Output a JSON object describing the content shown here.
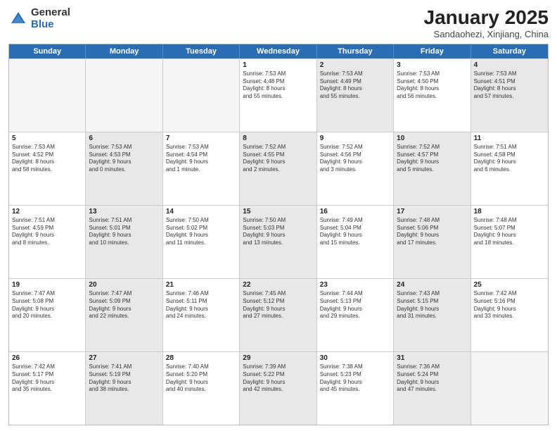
{
  "logo": {
    "general": "General",
    "blue": "Blue"
  },
  "header": {
    "title": "January 2025",
    "subtitle": "Sandaohezi, Xinjiang, China"
  },
  "weekdays": [
    "Sunday",
    "Monday",
    "Tuesday",
    "Wednesday",
    "Thursday",
    "Friday",
    "Saturday"
  ],
  "weeks": [
    [
      {
        "day": "",
        "empty": true,
        "shaded": false,
        "info": ""
      },
      {
        "day": "",
        "empty": true,
        "shaded": false,
        "info": ""
      },
      {
        "day": "",
        "empty": true,
        "shaded": false,
        "info": ""
      },
      {
        "day": "1",
        "empty": false,
        "shaded": false,
        "info": "Sunrise: 7:53 AM\nSunset: 4:48 PM\nDaylight: 8 hours\nand 55 minutes."
      },
      {
        "day": "2",
        "empty": false,
        "shaded": true,
        "info": "Sunrise: 7:53 AM\nSunset: 4:49 PM\nDaylight: 8 hours\nand 55 minutes."
      },
      {
        "day": "3",
        "empty": false,
        "shaded": false,
        "info": "Sunrise: 7:53 AM\nSunset: 4:50 PM\nDaylight: 8 hours\nand 56 minutes."
      },
      {
        "day": "4",
        "empty": false,
        "shaded": true,
        "info": "Sunrise: 7:53 AM\nSunset: 4:51 PM\nDaylight: 8 hours\nand 57 minutes."
      }
    ],
    [
      {
        "day": "5",
        "empty": false,
        "shaded": false,
        "info": "Sunrise: 7:53 AM\nSunset: 4:52 PM\nDaylight: 8 hours\nand 58 minutes."
      },
      {
        "day": "6",
        "empty": false,
        "shaded": true,
        "info": "Sunrise: 7:53 AM\nSunset: 4:53 PM\nDaylight: 9 hours\nand 0 minutes."
      },
      {
        "day": "7",
        "empty": false,
        "shaded": false,
        "info": "Sunrise: 7:53 AM\nSunset: 4:54 PM\nDaylight: 9 hours\nand 1 minute."
      },
      {
        "day": "8",
        "empty": false,
        "shaded": true,
        "info": "Sunrise: 7:52 AM\nSunset: 4:55 PM\nDaylight: 9 hours\nand 2 minutes."
      },
      {
        "day": "9",
        "empty": false,
        "shaded": false,
        "info": "Sunrise: 7:52 AM\nSunset: 4:56 PM\nDaylight: 9 hours\nand 3 minutes."
      },
      {
        "day": "10",
        "empty": false,
        "shaded": true,
        "info": "Sunrise: 7:52 AM\nSunset: 4:57 PM\nDaylight: 9 hours\nand 5 minutes."
      },
      {
        "day": "11",
        "empty": false,
        "shaded": false,
        "info": "Sunrise: 7:51 AM\nSunset: 4:58 PM\nDaylight: 9 hours\nand 6 minutes."
      }
    ],
    [
      {
        "day": "12",
        "empty": false,
        "shaded": false,
        "info": "Sunrise: 7:51 AM\nSunset: 4:59 PM\nDaylight: 9 hours\nand 8 minutes."
      },
      {
        "day": "13",
        "empty": false,
        "shaded": true,
        "info": "Sunrise: 7:51 AM\nSunset: 5:01 PM\nDaylight: 9 hours\nand 10 minutes."
      },
      {
        "day": "14",
        "empty": false,
        "shaded": false,
        "info": "Sunrise: 7:50 AM\nSunset: 5:02 PM\nDaylight: 9 hours\nand 11 minutes."
      },
      {
        "day": "15",
        "empty": false,
        "shaded": true,
        "info": "Sunrise: 7:50 AM\nSunset: 5:03 PM\nDaylight: 9 hours\nand 13 minutes."
      },
      {
        "day": "16",
        "empty": false,
        "shaded": false,
        "info": "Sunrise: 7:49 AM\nSunset: 5:04 PM\nDaylight: 9 hours\nand 15 minutes."
      },
      {
        "day": "17",
        "empty": false,
        "shaded": true,
        "info": "Sunrise: 7:48 AM\nSunset: 5:06 PM\nDaylight: 9 hours\nand 17 minutes."
      },
      {
        "day": "18",
        "empty": false,
        "shaded": false,
        "info": "Sunrise: 7:48 AM\nSunset: 5:07 PM\nDaylight: 9 hours\nand 18 minutes."
      }
    ],
    [
      {
        "day": "19",
        "empty": false,
        "shaded": false,
        "info": "Sunrise: 7:47 AM\nSunset: 5:08 PM\nDaylight: 9 hours\nand 20 minutes."
      },
      {
        "day": "20",
        "empty": false,
        "shaded": true,
        "info": "Sunrise: 7:47 AM\nSunset: 5:09 PM\nDaylight: 9 hours\nand 22 minutes."
      },
      {
        "day": "21",
        "empty": false,
        "shaded": false,
        "info": "Sunrise: 7:46 AM\nSunset: 5:11 PM\nDaylight: 9 hours\nand 24 minutes."
      },
      {
        "day": "22",
        "empty": false,
        "shaded": true,
        "info": "Sunrise: 7:45 AM\nSunset: 5:12 PM\nDaylight: 9 hours\nand 27 minutes."
      },
      {
        "day": "23",
        "empty": false,
        "shaded": false,
        "info": "Sunrise: 7:44 AM\nSunset: 5:13 PM\nDaylight: 9 hours\nand 29 minutes."
      },
      {
        "day": "24",
        "empty": false,
        "shaded": true,
        "info": "Sunrise: 7:43 AM\nSunset: 5:15 PM\nDaylight: 9 hours\nand 31 minutes."
      },
      {
        "day": "25",
        "empty": false,
        "shaded": false,
        "info": "Sunrise: 7:42 AM\nSunset: 5:16 PM\nDaylight: 9 hours\nand 33 minutes."
      }
    ],
    [
      {
        "day": "26",
        "empty": false,
        "shaded": false,
        "info": "Sunrise: 7:42 AM\nSunset: 5:17 PM\nDaylight: 9 hours\nand 35 minutes."
      },
      {
        "day": "27",
        "empty": false,
        "shaded": true,
        "info": "Sunrise: 7:41 AM\nSunset: 5:19 PM\nDaylight: 9 hours\nand 38 minutes."
      },
      {
        "day": "28",
        "empty": false,
        "shaded": false,
        "info": "Sunrise: 7:40 AM\nSunset: 5:20 PM\nDaylight: 9 hours\nand 40 minutes."
      },
      {
        "day": "29",
        "empty": false,
        "shaded": true,
        "info": "Sunrise: 7:39 AM\nSunset: 5:22 PM\nDaylight: 9 hours\nand 42 minutes."
      },
      {
        "day": "30",
        "empty": false,
        "shaded": false,
        "info": "Sunrise: 7:38 AM\nSunset: 5:23 PM\nDaylight: 9 hours\nand 45 minutes."
      },
      {
        "day": "31",
        "empty": false,
        "shaded": true,
        "info": "Sunrise: 7:36 AM\nSunset: 5:24 PM\nDaylight: 9 hours\nand 47 minutes."
      },
      {
        "day": "",
        "empty": true,
        "shaded": false,
        "info": ""
      }
    ]
  ]
}
